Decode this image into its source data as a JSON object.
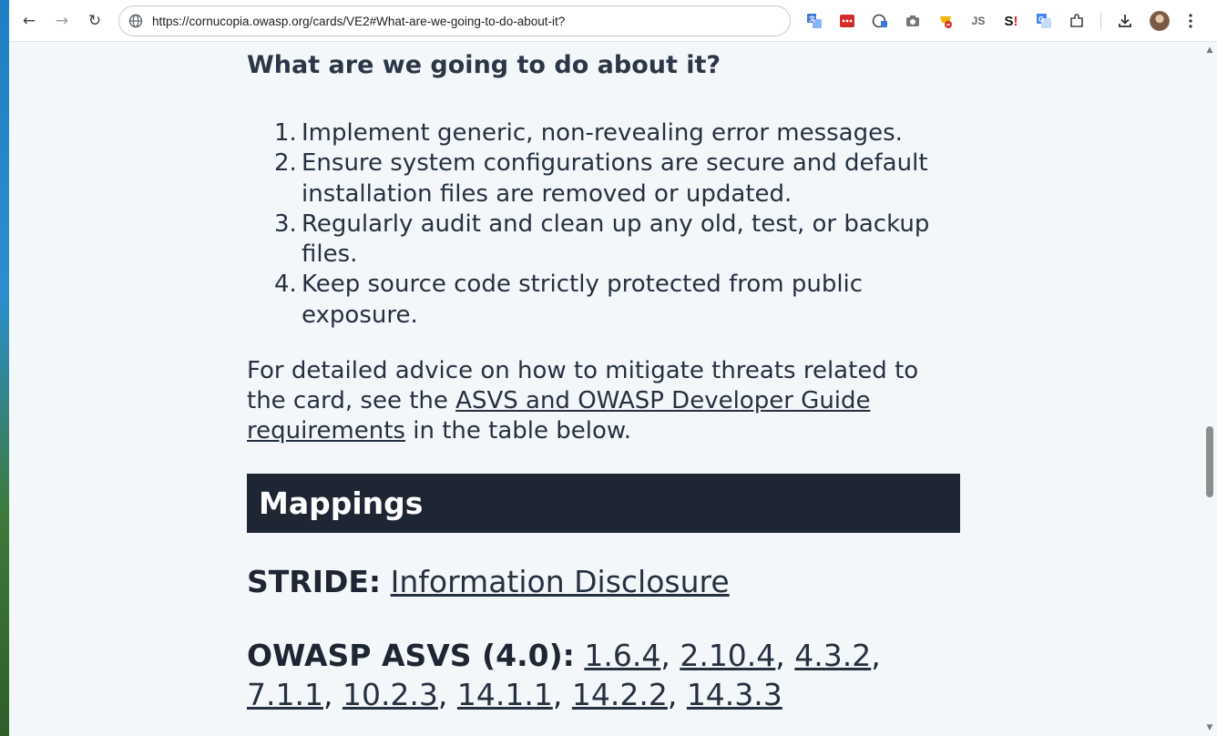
{
  "browser": {
    "url": "https://cornucopia.owasp.org/cards/VE2#What-are-we-going-to-do-about-it?",
    "back_glyph": "←",
    "forward_glyph": "→",
    "reload_glyph": "↻",
    "extensions": [
      "translate-icon",
      "lastpass-icon",
      "privacy-icon",
      "camera-icon",
      "shopping-icon",
      "js-icon",
      "s-icon",
      "google-translate-icon",
      "puzzle-icon"
    ]
  },
  "section": {
    "heading": "What are we going to do about it?",
    "steps": [
      {
        "num": "1.",
        "text": "Implement generic, non-revealing error messages."
      },
      {
        "num": "2.",
        "text": "Ensure system configurations are secure and default installation files are removed or updated."
      },
      {
        "num": "3.",
        "text": "Regularly audit and clean up any old, test, or backup files."
      },
      {
        "num": "4.",
        "text": "Keep source code strictly protected from public exposure."
      }
    ],
    "advice_before": "For detailed advice on how to mitigate threats related to the card, see the",
    "advice_link": "ASVS and OWASP Developer Guide requirements",
    "advice_after": "in the table below."
  },
  "mappings": {
    "title": "Mappings",
    "stride_label": "STRIDE:",
    "stride_value": "Information Disclosure",
    "asvs_label": "OWASP ASVS (4.0):",
    "asvs_links": [
      "1.6.4",
      "2.10.4",
      "4.3.2",
      "7.1.1",
      "10.2.3",
      "14.1.1",
      "14.2.2",
      "14.3.3"
    ]
  }
}
